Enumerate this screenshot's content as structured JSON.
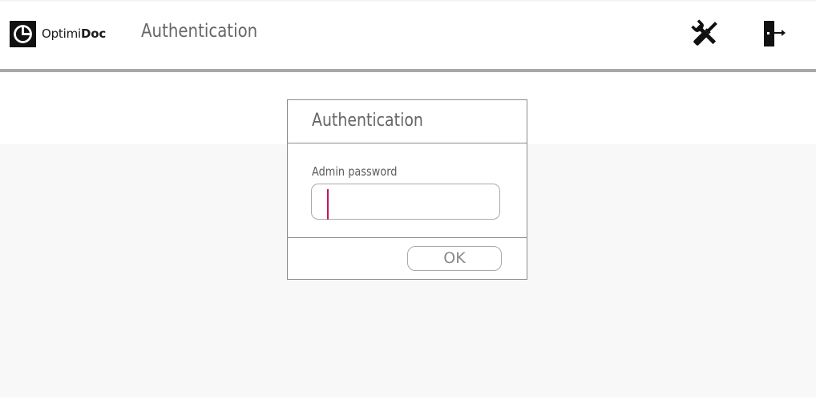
{
  "header": {
    "logo_text_regular": "Optimi",
    "logo_text_bold": "Doc",
    "title": "Authentication",
    "tools_icon": "tools-icon",
    "exit_icon": "exit-door-icon"
  },
  "dialog": {
    "title": "Authentication",
    "field_label": "Admin password",
    "password_value": "",
    "ok_label": "OK"
  },
  "colors": {
    "accent_caret": "#c2185b",
    "header_rule": "#a8a8a8",
    "content_background": "#f8f8f8",
    "text_gray": "#666666"
  }
}
